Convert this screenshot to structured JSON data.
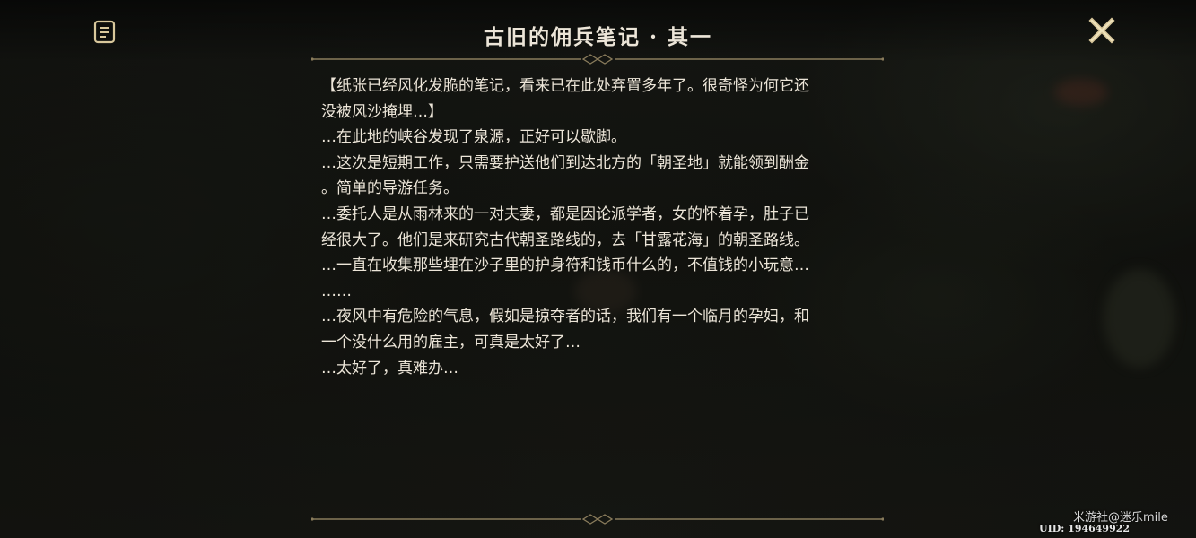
{
  "header": {
    "title": "古旧的佣兵笔记 · 其一",
    "book_icon": "book-list-icon",
    "close_icon": "close-icon"
  },
  "content": {
    "paragraphs": [
      "【纸张已经风化发脆的笔记，看来已在此处弃置多年了。很奇怪为何它还\n没被风沙掩埋…】",
      "…在此地的峡谷发现了泉源，正好可以歇脚。",
      "…这次是短期工作，只需要护送他们到达北方的「朝圣地」就能领到酬金\n。简单的导游任务。",
      "…委托人是从雨林来的一对夫妻，都是因论派学者，女的怀着孕，肚子已\n经很大了。他们是来研究古代朝圣路线的，去「甘露花海」的朝圣路线。",
      "…一直在收集那些埋在沙子里的护身符和钱币什么的，不值钱的小玩意…\n……",
      "…夜风中有危险的气息，假如是掠夺者的话，我们有一个临月的孕妇，和\n一个没什么用的雇主，可真是太好了…",
      "…太好了，真难办…"
    ]
  },
  "footer": {
    "watermark": "米游社@迷乐mile",
    "uid": "UID: 194649922"
  },
  "colors": {
    "text": "#ece5d8",
    "divider": "#8a7c5c",
    "icon": "#d8c79b"
  }
}
